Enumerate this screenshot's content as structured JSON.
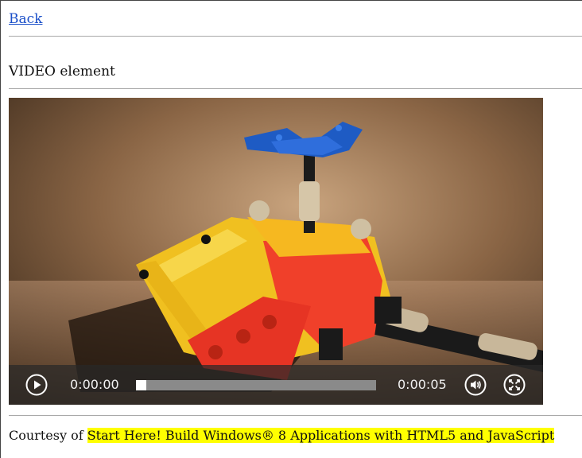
{
  "nav": {
    "back_label": "Back"
  },
  "section": {
    "title": "VIDEO element"
  },
  "video": {
    "controls": {
      "current_time": "0:00:00",
      "total_time": "0:00:05",
      "progress": 0,
      "play_icon": "play-icon",
      "volume_icon": "volume-icon",
      "fullscreen_icon": "fullscreen-icon"
    }
  },
  "footer": {
    "prefix": "Courtesy of ",
    "highlighted_text": "Start Here! Build Windows® 8 Applications with HTML5 and JavaScript"
  },
  "colors": {
    "link": "#1a4fc9",
    "highlight": "#ffff00",
    "divider": "#a8a8a8",
    "control_bar": "#282828"
  }
}
